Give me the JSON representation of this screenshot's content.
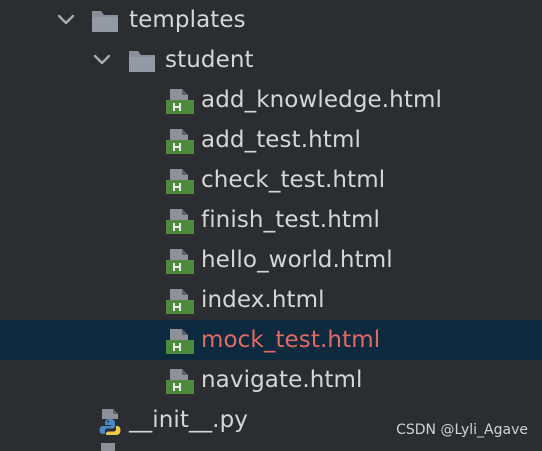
{
  "tree": {
    "folders": [
      {
        "label": "templates",
        "icon": "folder-icon",
        "expanded": true
      },
      {
        "label": "student",
        "icon": "folder-icon",
        "expanded": true
      }
    ],
    "files": [
      {
        "label": "add_knowledge.html",
        "icon": "html-file-icon"
      },
      {
        "label": "add_test.html",
        "icon": "html-file-icon"
      },
      {
        "label": "check_test.html",
        "icon": "html-file-icon"
      },
      {
        "label": "finish_test.html",
        "icon": "html-file-icon"
      },
      {
        "label": "hello_world.html",
        "icon": "html-file-icon"
      },
      {
        "label": "index.html",
        "icon": "html-file-icon"
      },
      {
        "label": "mock_test.html",
        "icon": "html-file-icon",
        "selected": true
      },
      {
        "label": "navigate.html",
        "icon": "html-file-icon"
      }
    ],
    "python_file": {
      "label": "__init__.py",
      "icon": "python-file-icon"
    }
  },
  "watermark": "CSDN @Lyli_Agave",
  "colors": {
    "background": "#2b2d30",
    "selection": "#0e2a3f",
    "text": "#d4d6da",
    "selected_text": "#e16a62",
    "folder": "#8a9099",
    "html_icon": "#4e8a3e"
  }
}
